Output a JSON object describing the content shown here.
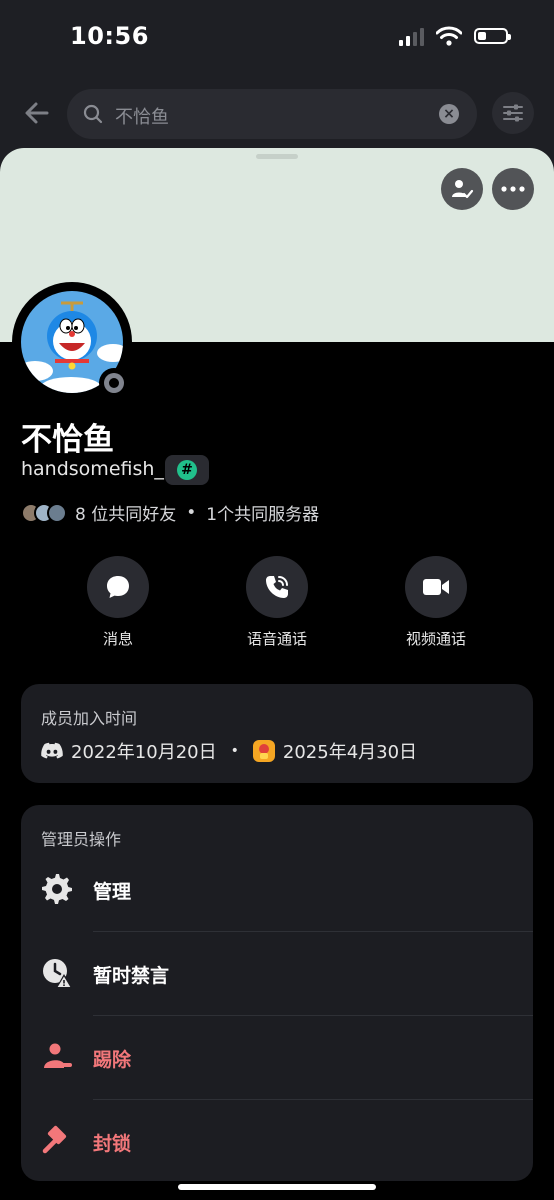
{
  "status_bar": {
    "time": "10:56"
  },
  "search": {
    "query": "不恰鱼"
  },
  "profile": {
    "display_name": "不恰鱼",
    "username": "handsomefish_",
    "mutual_friends": "8 位共同好友",
    "separator": "•",
    "mutual_servers": "1个共同服务器"
  },
  "actions": [
    {
      "label": "消息",
      "icon": "message-icon"
    },
    {
      "label": "语音通话",
      "icon": "phone-icon"
    },
    {
      "label": "视频通话",
      "icon": "video-icon"
    }
  ],
  "member_since": {
    "title": "成员加入时间",
    "discord_date": "2022年10月20日",
    "separator": "•",
    "server_date": "2025年4月30日"
  },
  "admin": {
    "title": "管理员操作",
    "items": [
      {
        "label": "管理",
        "icon": "gear-icon"
      },
      {
        "label": "暂时禁言",
        "icon": "timeout-icon"
      },
      {
        "label": "踢除",
        "icon": "kick-icon"
      },
      {
        "label": "封锁",
        "icon": "ban-hammer-icon"
      }
    ]
  },
  "colors": {
    "background": "#000000",
    "card": "#1c1d22",
    "banner": "#dde8e0",
    "danger": "#f2777a",
    "tag_accent": "#21c08b"
  }
}
